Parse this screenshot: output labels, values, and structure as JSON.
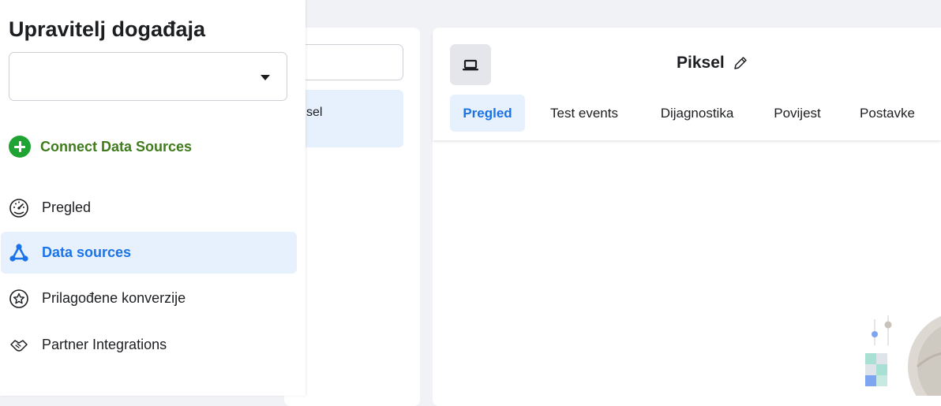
{
  "sidebar": {
    "title": "Upravitelj događaja",
    "source_select_value": "",
    "connect_label": "Connect Data Sources",
    "items": [
      {
        "label": "Pregled",
        "icon": "speedometer-icon",
        "active": false
      },
      {
        "label": "Data sources",
        "icon": "network-nodes-icon",
        "active": true
      },
      {
        "label": "Prilagođene konverzije",
        "icon": "star-circle-icon",
        "active": false
      },
      {
        "label": "Partner Integrations",
        "icon": "handshake-icon",
        "active": false
      }
    ]
  },
  "middle": {
    "search_value": "",
    "selected_item_label": "sel"
  },
  "main": {
    "title": "Piksel",
    "tabs": [
      {
        "label": "Pregled",
        "active": true
      },
      {
        "label": "Test events",
        "active": false
      },
      {
        "label": "Dijagnostika",
        "active": false
      },
      {
        "label": "Povijest",
        "active": false
      },
      {
        "label": "Postavke",
        "active": false
      }
    ]
  },
  "colors": {
    "accent": "#1a73e8",
    "accent_bg": "#e7f0fd",
    "connect_green": "#1fa433",
    "connect_text": "#3f7b1c",
    "page_bg": "#f0f2f5"
  }
}
